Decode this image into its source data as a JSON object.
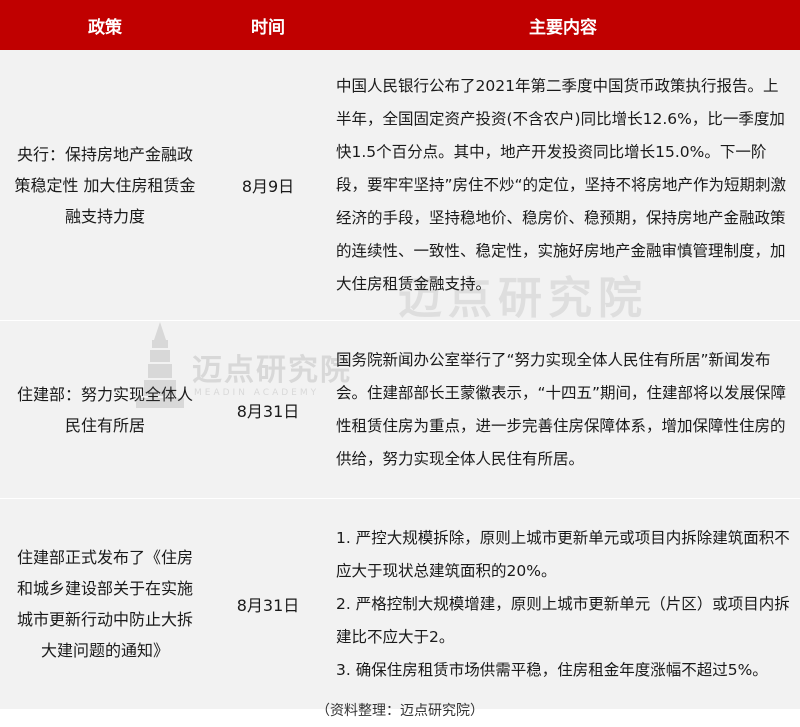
{
  "header": {
    "col_policy": "政策",
    "col_time": "时间",
    "col_content": "主要内容"
  },
  "rows": [
    {
      "policy": "央行：保持房地产金融政策稳定性 加大住房租赁金融支持力度",
      "time": "8月9日",
      "content": "中国人民银行公布了2021年第二季度中国货币政策执行报告。上半年，全国固定资产投资(不含农户)同比增长12.6%，比一季度加快1.5个百分点。其中，地产开发投资同比增长15.0%。下一阶段，要牢牢坚持”房住不炒“的定位，坚持不将房地产作为短期刺激经济的手段，坚持稳地价、稳房价、稳预期，保持房地产金融政策的连续性、一致性、稳定性，实施好房地产金融审慎管理制度，加大住房租赁金融支持。"
    },
    {
      "policy": "住建部：努力实现全体人民住有所居",
      "time": "8月31日",
      "content": "国务院新闻办公室举行了“努力实现全体人民住有所居”新闻发布会。住建部部长王蒙徽表示，“十四五”期间，住建部将以发展保障性租赁住房为重点，进一步完善住房保障体系，增加保障性住房的供给，努力实现全体人民住有所居。"
    },
    {
      "policy": "住建部正式发布了《住房和城乡建设部关于在实施城市更新行动中防止大拆大建问题的通知》",
      "time": "8月31日",
      "content_items": [
        "1. 严控大规模拆除，原则上城市更新单元或项目内拆除建筑面积不应大于现状总建筑面积的20%。",
        "2. 严格控制大规模增建，原则上城市更新单元（片区）或项目内拆建比不应大于2。",
        "3. 确保住房租赁市场供需平稳，住房租金年度涨幅不超过5%。"
      ]
    }
  ],
  "source": "（资料整理：迈点研究院）",
  "watermark": {
    "brand": "迈点研究院",
    "sub": "MEADIN ACADEMY"
  },
  "colors": {
    "header_bg": "#c00000",
    "row_bg": "#f2f2f2"
  }
}
